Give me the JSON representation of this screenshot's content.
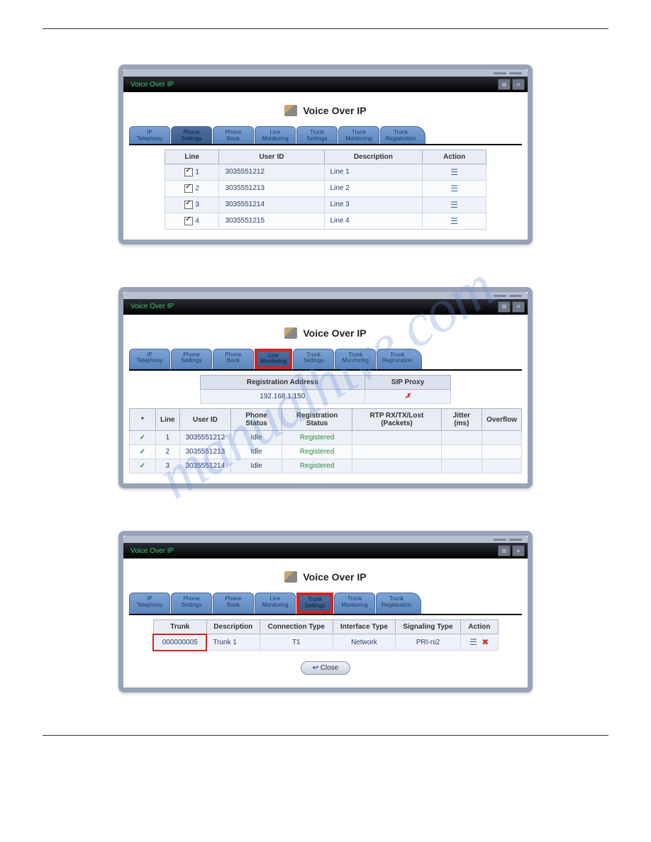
{
  "watermark": "manualhive.com",
  "title": "Voice Over IP",
  "heading": "Voice Over IP",
  "close_label": "Close",
  "tabs": [
    {
      "l1": "IP",
      "l2": "Telephony"
    },
    {
      "l1": "Phone",
      "l2": "Settings"
    },
    {
      "l1": "Phone",
      "l2": "Book"
    },
    {
      "l1": "Line",
      "l2": "Monitoring"
    },
    {
      "l1": "Trunk",
      "l2": "Settings"
    },
    {
      "l1": "Trunk",
      "l2": "Monitoring"
    },
    {
      "l1": "Trunk",
      "l2": "Registration"
    }
  ],
  "panel1": {
    "headers": [
      "Line",
      "User ID",
      "Description",
      "Action"
    ],
    "rows": [
      {
        "line": "1",
        "user": "3035551212",
        "desc": "Line 1"
      },
      {
        "line": "2",
        "user": "3035551213",
        "desc": "Line 2"
      },
      {
        "line": "3",
        "user": "3035551214",
        "desc": "Line 3"
      },
      {
        "line": "4",
        "user": "3035551215",
        "desc": "Line 4"
      }
    ]
  },
  "panel2": {
    "reg_addr_label": "Registration Address",
    "sip_label": "SIP Proxy",
    "reg_addr": "192.168.1.150",
    "sip": "✗",
    "headers": [
      "*",
      "Line",
      "User ID",
      "Phone Status",
      "Registration Status",
      "RTP RX/TX/Lost (Packets)",
      "Jitter (ms)",
      "Overflow"
    ],
    "rows": [
      {
        "line": "1",
        "user": "3035551212",
        "phone": "Idle",
        "reg": "Registered"
      },
      {
        "line": "2",
        "user": "3035551213",
        "phone": "Idle",
        "reg": "Registered"
      },
      {
        "line": "3",
        "user": "3035551214",
        "phone": "Idle",
        "reg": "Registered"
      }
    ]
  },
  "panel3": {
    "headers": [
      "Trunk",
      "Description",
      "Connection Type",
      "Interface Type",
      "Signaling Type",
      "Action"
    ],
    "row": {
      "trunk": "000000005",
      "desc": "Trunk 1",
      "conn": "T1",
      "iface": "Network",
      "sig": "PRI-ni2"
    }
  }
}
